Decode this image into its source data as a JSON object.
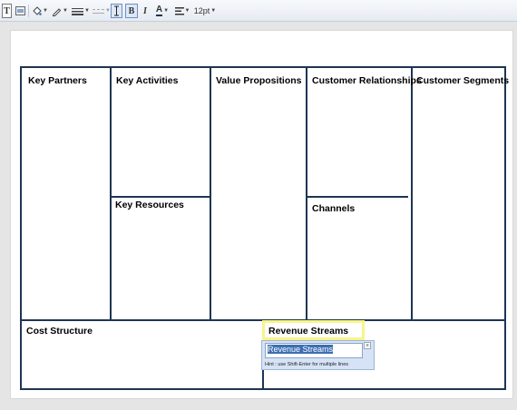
{
  "toolbar": {
    "font_size": "12pt",
    "bold_label": "B",
    "italic_label": "I",
    "font_color_label": "A",
    "accent": "#1e3553"
  },
  "canvas": {
    "cells": {
      "key_partners": "Key Partners",
      "key_activities": "Key Activities",
      "key_resources": "Key Resources",
      "value_propositions": "Value Propositions",
      "customer_relationships": "Customer Relationships",
      "channels": "Channels",
      "customer_segments": "Customer Segments",
      "cost_structure": "Cost Structure",
      "revenue_streams": "Revenue Streams"
    }
  },
  "editor": {
    "value": "Revenue Streams",
    "hint": "Hint : use Shift-Enter for multiple lines",
    "close_label": "×"
  }
}
